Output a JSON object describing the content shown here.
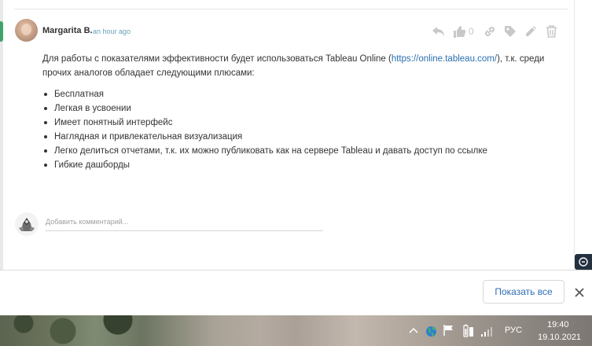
{
  "post": {
    "author": "Margarita B.",
    "timestamp": "an hour ago",
    "like_count": "0",
    "actions": [
      "reply-icon",
      "like-icon",
      "link-icon",
      "tag-icon",
      "edit-icon",
      "delete-icon"
    ],
    "body_before_link": "Для работы с показателями эффективности будет использоваться Tableau Online (",
    "link_text": "https://online.tableau.com/",
    "body_after_link": "), т.к. среди прочих аналогов обладает следующими плюсами:",
    "bullets": [
      "Бесплатная",
      "Легкая в усвоении",
      "Имеет понятный интерфейс",
      "Наглядная и привлекательная визуализация",
      "Легко делиться отчетами, т.к. их можно публиковать как на сервере Tableau и давать доступ по ссылке",
      "Гибкие дашборды"
    ]
  },
  "comment_box": {
    "placeholder": "Добавить комментарий..."
  },
  "notice_bar": {
    "show_all_label": "Показать все"
  },
  "taskbar": {
    "language": "РУС",
    "time": "19:40",
    "date": "19.10.2021"
  },
  "colors": {
    "link": "#2a6fb0",
    "accent_green": "#3fa46a",
    "button_text": "#2f6cb4"
  }
}
